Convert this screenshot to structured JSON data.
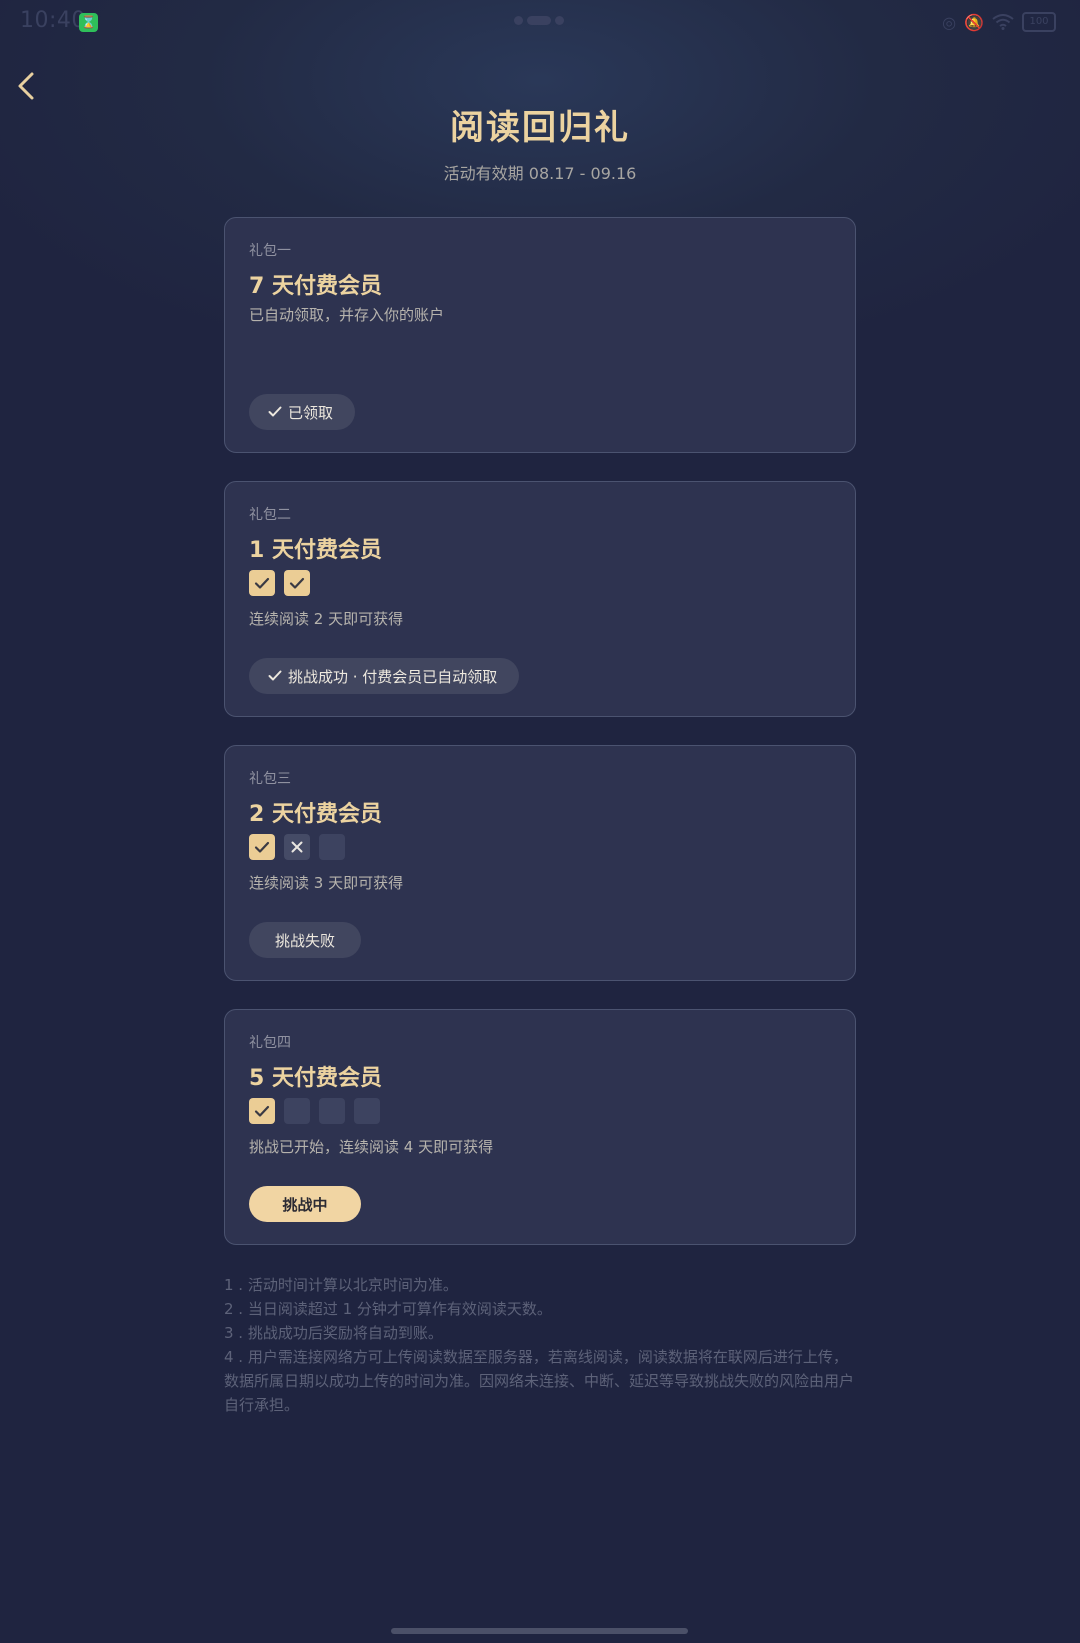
{
  "status_bar": {
    "time": "10:40",
    "app_badge_icon": "hourglass-icon",
    "battery": "100"
  },
  "header": {
    "title": "阅读回归礼",
    "period": "活动有效期 08.17 - 09.16"
  },
  "colors": {
    "accent": "#ecd3a0",
    "card_bg": "#2e3350",
    "page_bg": "#1f2440",
    "pill_bg": "#41465f",
    "active_pill_bg": "#f1d5a3"
  },
  "gifts": [
    {
      "label": "礼包一",
      "title": "7 天付费会员",
      "desc": "已自动领取，并存入你的账户",
      "status": "已领取",
      "progress": []
    },
    {
      "label": "礼包二",
      "title": "1 天付费会员",
      "desc": "连续阅读 2 天即可获得",
      "status": "挑战成功 · 付费会员已自动领取",
      "progress": [
        "done",
        "done"
      ]
    },
    {
      "label": "礼包三",
      "title": "2 天付费会员",
      "desc": "连续阅读 3 天即可获得",
      "status": "挑战失败",
      "progress": [
        "done",
        "fail",
        "empty"
      ]
    },
    {
      "label": "礼包四",
      "title": "5 天付费会员",
      "desc": "挑战已开始，连续阅读 4 天即可获得",
      "status": "挑战中",
      "progress": [
        "done",
        "empty",
        "empty",
        "empty"
      ]
    }
  ],
  "rules": [
    "1 . 活动时间计算以北京时间为准。",
    "2 . 当日阅读超过 1 分钟才可算作有效阅读天数。",
    "3 . 挑战成功后奖励将自动到账。",
    "4 . 用户需连接网络方可上传阅读数据至服务器，若离线阅读，阅读数据将在联网后进行上传，数据所属日期以成功上传的时间为准。因网络未连接、中断、延迟等导致挑战失败的风险由用户自行承担。"
  ]
}
